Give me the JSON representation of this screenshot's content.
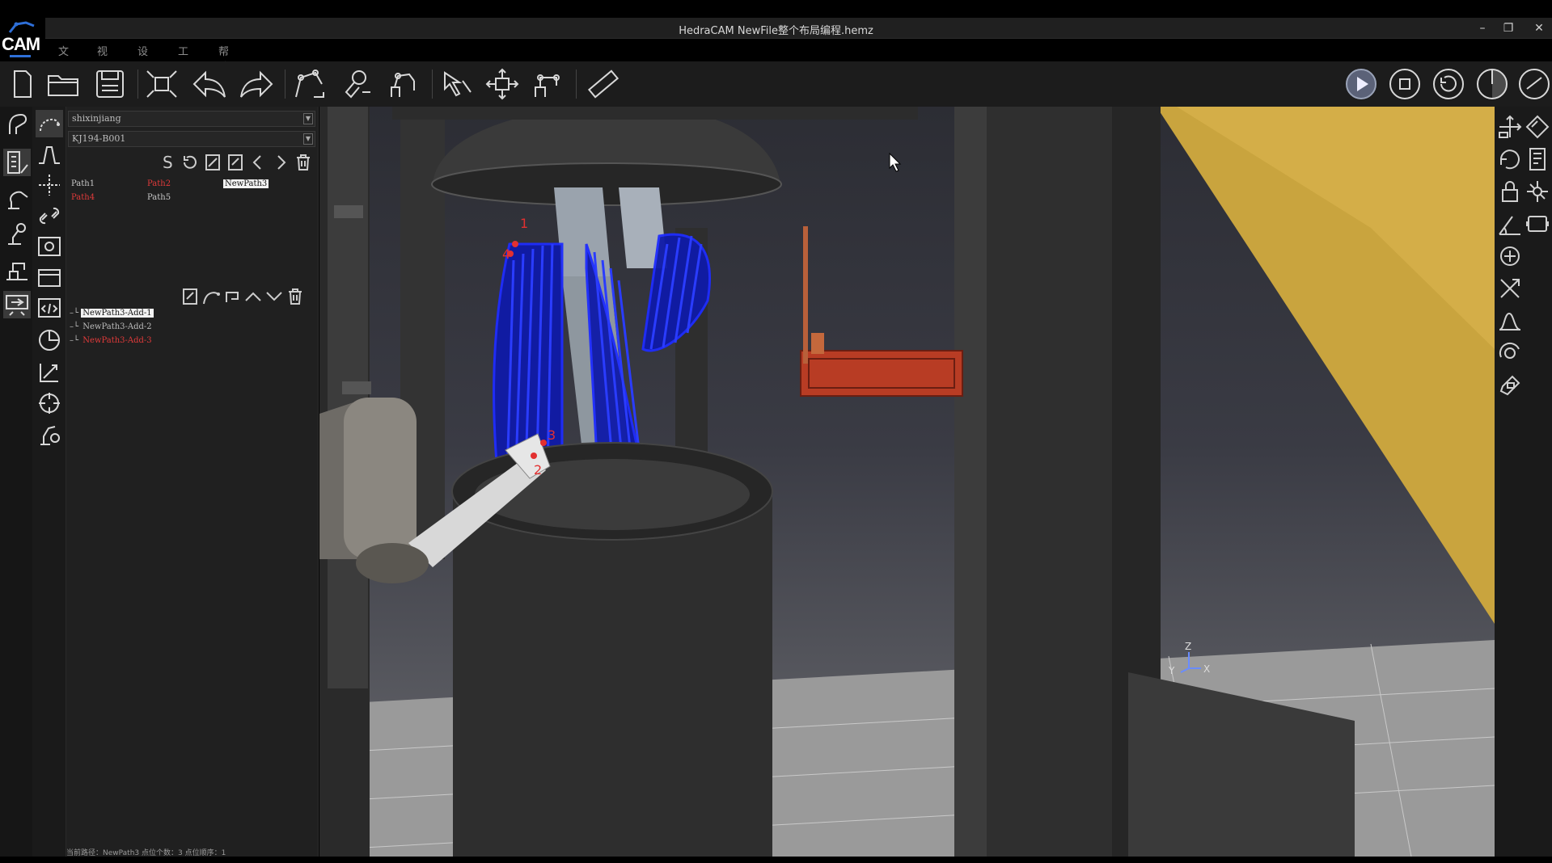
{
  "window": {
    "title": "HedraCAM  NewFile整个布局编程.hemz",
    "minimize": "–",
    "restore": "❐",
    "close": "✕"
  },
  "logo": {
    "text": "CAM"
  },
  "menu": [
    "文件",
    "视图",
    "设置",
    "工具",
    "帮助"
  ],
  "toolbar": {
    "left_icons": [
      "new-file-icon",
      "open-folder-icon",
      "save-icon",
      "fit-view-icon",
      "undo-icon",
      "redo-icon",
      "path-tool-icon",
      "robot-teach-icon",
      "robot-frame-icon",
      "select-cursor-icon",
      "move-icon",
      "robot-base-icon",
      "ruler-icon"
    ],
    "right_icons": [
      "play-icon",
      "stop-icon",
      "reset-icon",
      "half-circle-icon",
      "rotate-icon"
    ]
  },
  "panel": {
    "robot_select": "shixinjiang",
    "tool_select": "KJ194-B001",
    "path_tools": [
      "S",
      "refresh-icon",
      "edit-icon",
      "edit2-icon",
      "prev-icon",
      "next-icon",
      "trash-icon"
    ],
    "paths": [
      {
        "label": "Path1",
        "state": "normal"
      },
      {
        "label": "Path2",
        "state": "red"
      },
      {
        "label": "NewPath3",
        "state": "selected"
      },
      {
        "label": "Path4",
        "state": "red"
      },
      {
        "label": "Path5",
        "state": "normal"
      }
    ],
    "sub_tools": [
      "edit-icon",
      "curve-icon",
      "loop-icon",
      "up-icon",
      "down-icon",
      "trash-icon"
    ],
    "sub_paths": [
      {
        "label": "NewPath3-Add-1",
        "state": "selected"
      },
      {
        "label": "NewPath3-Add-2",
        "state": "normal"
      },
      {
        "label": "NewPath3-Add-3",
        "state": "red"
      }
    ],
    "status": "当前路径：NewPath3    点位个数：3    点位顺序：1"
  },
  "viewport": {
    "axis": {
      "z": "Z",
      "y": "Y",
      "x": "X"
    },
    "point_labels": [
      "1",
      "2",
      "3",
      "4"
    ]
  },
  "colors": {
    "toolpath": "#1e2cff",
    "accent": "#2e6fd8",
    "path_red": "#e03a3a",
    "gold_panel": "#d4b04a"
  }
}
